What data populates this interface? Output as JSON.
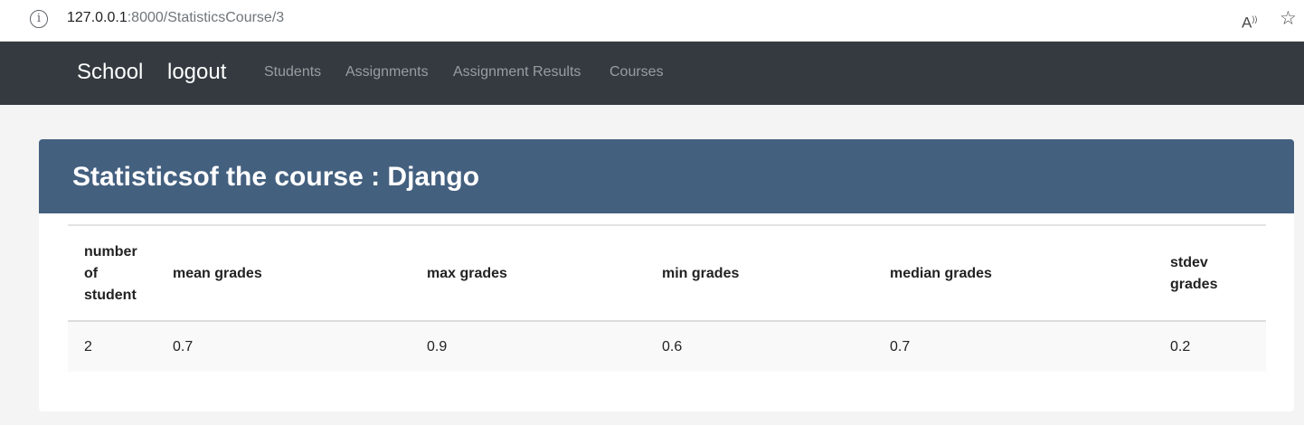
{
  "browser": {
    "url_host": "127.0.0.1",
    "url_rest": ":8000/StatisticsCourse/3"
  },
  "navbar": {
    "brand": "School",
    "logout": "logout",
    "links": [
      "Students",
      "Assignments",
      "Assignment Results",
      "Courses"
    ]
  },
  "page": {
    "title": "Statisticsof the course : Django"
  },
  "table": {
    "headers": [
      "number of student",
      "mean grades",
      "max grades",
      "min grades",
      "median grades",
      "stdev grades"
    ],
    "rows": [
      [
        "2",
        "0.7",
        "0.9",
        "0.6",
        "0.7",
        "0.2"
      ]
    ]
  }
}
